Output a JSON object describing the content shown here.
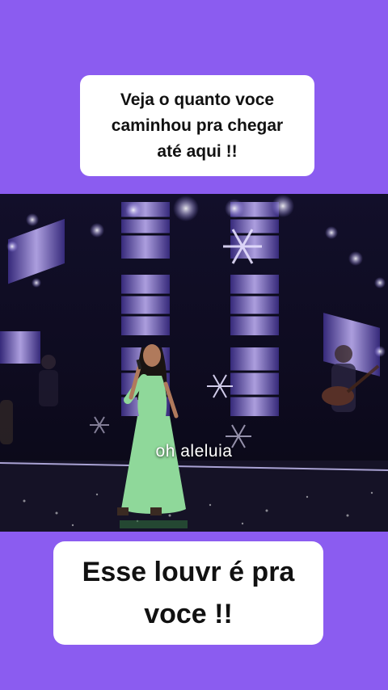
{
  "top_caption": {
    "text": "Veja o quanto voce\ncaminhou pra chegar\naté aqui !!"
  },
  "video": {
    "subtitle": "oh aleluia"
  },
  "bottom_caption": {
    "text": "Esse louvr é pra\nvoce !!"
  },
  "colors": {
    "background": "#8b5cf0",
    "caption_bg": "#ffffff",
    "stage_light": "#b89cff",
    "dress": "#8fd89a"
  }
}
